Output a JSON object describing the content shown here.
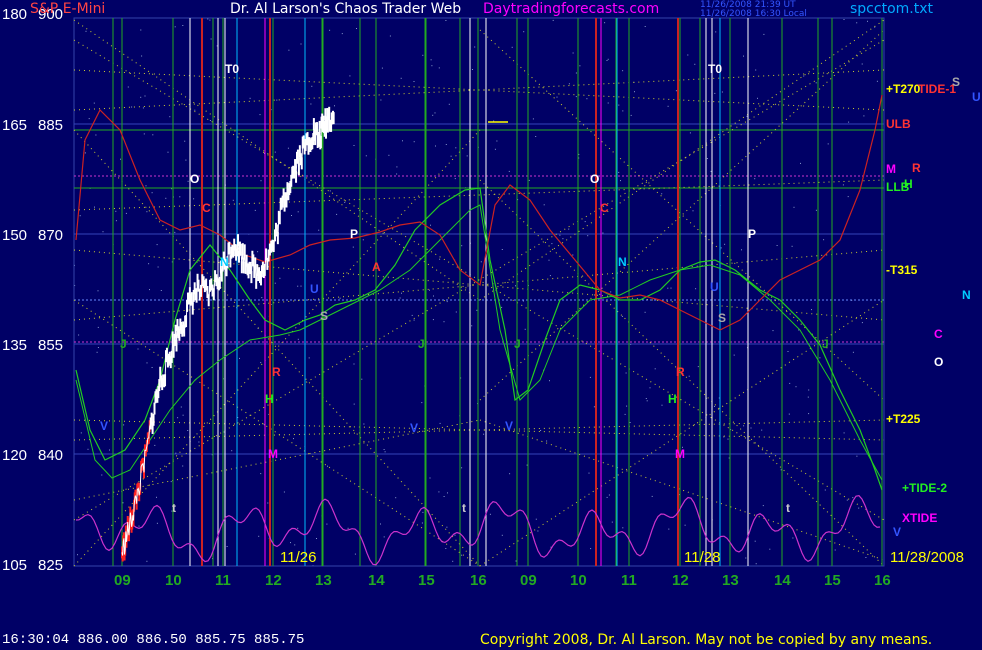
{
  "header": {
    "title_left": "S&P E-Mini",
    "title_center": "Dr. Al Larson's Chaos Trader Web",
    "url": "Daytradingforecasts.com",
    "file": "spcctom.txt",
    "stamp1": "11/26/2008 21:39 UT",
    "stamp2": "11/26/2008 16:30 Local"
  },
  "footer": {
    "status": "16:30:04  886.00 886.50 885.75 885.75",
    "copyright": "Copyright 2008, Dr. Al Larson. May not be copied by any means."
  },
  "chart_data": {
    "type": "line",
    "y_axis_price": {
      "ticks": [
        900,
        885,
        870,
        855,
        840,
        825
      ],
      "range": [
        825,
        900
      ]
    },
    "y_axis_osc": {
      "ticks": [
        180,
        165,
        150,
        135,
        120,
        105
      ]
    },
    "x_ticks": [
      "09",
      "10",
      "11",
      "12",
      "13",
      "14",
      "15",
      "16",
      "09",
      "10",
      "11",
      "12",
      "13",
      "14",
      "15",
      "16"
    ],
    "date_labels": [
      "11/26",
      "11/28",
      "11/28/2008"
    ],
    "colors": {
      "background": "#000066",
      "price": "#ffffff",
      "wave_green": "#22cc22",
      "wave_red": "#cc2222",
      "xtide": "#cc33cc",
      "dots": "#cccc33",
      "grid_green": "#22aa22"
    },
    "right_labels": [
      {
        "text": "+T270",
        "color": "#ffff00"
      },
      {
        "text": "TIDE-1",
        "color": "#ff3333"
      },
      {
        "text": "S",
        "color": "#aaaaaa"
      },
      {
        "text": "U",
        "color": "#3355ff"
      },
      {
        "text": "ULB",
        "color": "#ff3333"
      },
      {
        "text": "M",
        "color": "#ff00ff"
      },
      {
        "text": "R",
        "color": "#ff3333"
      },
      {
        "text": "LLB",
        "color": "#22ee22"
      },
      {
        "text": "H",
        "color": "#22ee22"
      },
      {
        "text": "-T315",
        "color": "#ffff00"
      },
      {
        "text": "N",
        "color": "#00ccff"
      },
      {
        "text": "C",
        "color": "#ff00ff"
      },
      {
        "text": "O",
        "color": "#ffffff"
      },
      {
        "text": "+T225",
        "color": "#ffff00"
      },
      {
        "text": "+TIDE-2",
        "color": "#22ee22"
      },
      {
        "text": "XTIDE",
        "color": "#ff00ff"
      }
    ],
    "planet_labels_day1": [
      "T0",
      "O",
      "C",
      "N",
      "P",
      "S",
      "V",
      "M",
      "H",
      "J",
      "A",
      "U",
      "R",
      "t"
    ],
    "planet_labels_day2": [
      "T0",
      "O",
      "C",
      "N",
      "P",
      "S",
      "V",
      "M",
      "H",
      "J",
      "U",
      "R",
      "t"
    ],
    "price_series": [
      [
        0.0,
        826.5
      ],
      [
        0.1,
        829.0
      ],
      [
        0.2,
        831.5
      ],
      [
        0.3,
        834.5
      ],
      [
        0.45,
        839.0
      ],
      [
        0.6,
        845.0
      ],
      [
        0.75,
        850.0
      ],
      [
        0.9,
        852.5
      ],
      [
        1.05,
        856.0
      ],
      [
        1.2,
        858.0
      ],
      [
        1.35,
        861.0
      ],
      [
        1.5,
        862.5
      ],
      [
        1.7,
        861.5
      ],
      [
        1.9,
        864.0
      ],
      [
        2.05,
        866.5
      ],
      [
        2.2,
        869.0
      ],
      [
        2.35,
        867.0
      ],
      [
        2.5,
        866.0
      ],
      [
        2.65,
        864.5
      ],
      [
        2.8,
        866.0
      ],
      [
        3.0,
        869.0
      ],
      [
        3.15,
        874.0
      ],
      [
        3.3,
        877.5
      ],
      [
        3.45,
        880.0
      ],
      [
        3.6,
        882.0
      ],
      [
        3.75,
        884.0
      ],
      [
        3.85,
        883.0
      ],
      [
        3.95,
        884.5
      ],
      [
        4.05,
        886.0
      ],
      [
        4.15,
        885.8
      ]
    ],
    "start_price": 826.5,
    "end_price": 885.75
  }
}
